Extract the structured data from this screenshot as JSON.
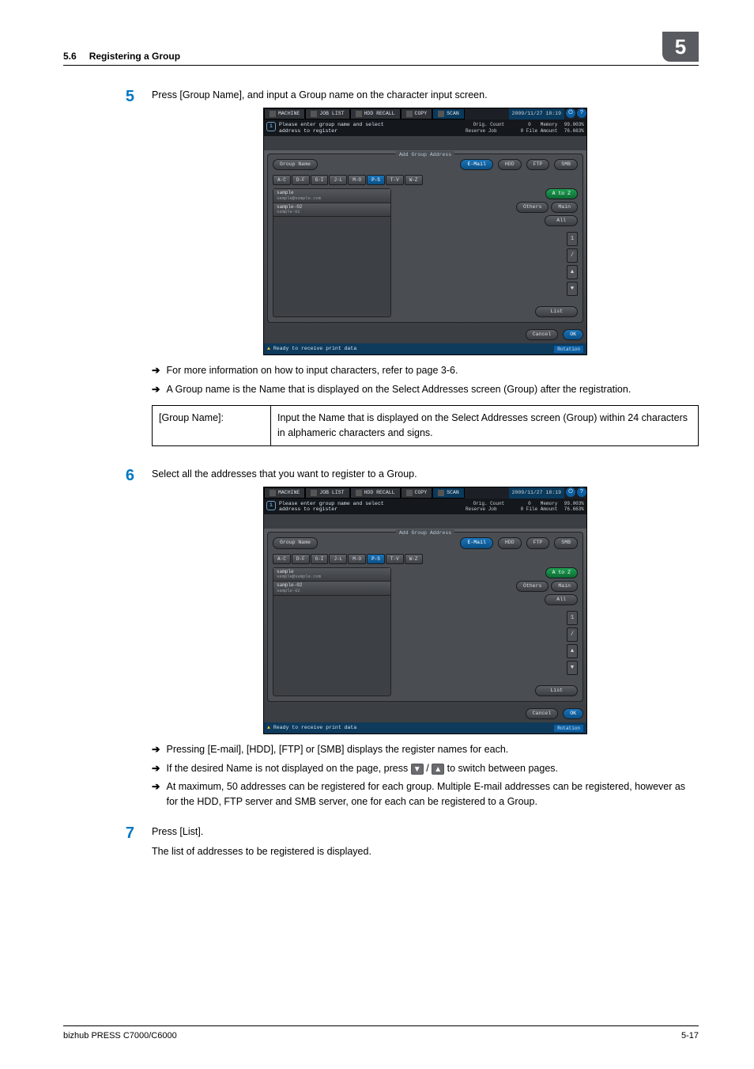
{
  "header": {
    "section_num": "5.6",
    "section_title": "Registering a Group",
    "chapter_num": "5"
  },
  "steps": {
    "s5": {
      "num": "5",
      "text": "Press [Group Name], and input a Group name on the character input screen."
    },
    "s5_arrows": [
      "For more information on how to input characters, refer to page 3-6.",
      "A Group name is the Name that is displayed on the Select Addresses screen (Group) after the registration."
    ],
    "s5_table": {
      "label": "[Group Name]:",
      "desc": "Input the Name that is displayed on the Select Addresses screen (Group) within 24 characters in alphameric characters and signs."
    },
    "s6": {
      "num": "6",
      "text": "Select all the addresses that you want to register to a Group."
    },
    "s6_arrows": [
      "Pressing [E-mail], [HDD], [FTP] or [SMB] displays the register names for each.",
      "If the desired Name is not displayed on the page, press",
      "to switch between pages.",
      "At maximum, 50 addresses can be registered for each group. Multiple E-mail addresses can be registered, however as for the HDD, FTP server and SMB server, one for each can be registered to a Group."
    ],
    "s7": {
      "num": "7",
      "text": "Press [List].",
      "text2": "The list of addresses to be registered is displayed."
    }
  },
  "device": {
    "topbar": {
      "machine": "MACHINE",
      "joblist": "JOB LIST",
      "hddrecall": "HDD RECALL",
      "copy": "COPY",
      "scan": "SCAN",
      "timestamp": "2009/11/27 18:19"
    },
    "info": {
      "msg_l1": "Please enter group name and select",
      "msg_l2": "address to register",
      "orig_count_l": "Orig. Count",
      "orig_count_v": "0",
      "memory_l": "Memory",
      "memory_v": "99.003%",
      "reserve_l": "Reserve Job",
      "reserve_v": "0",
      "fileamt_l": "File Amount",
      "fileamt_v": "76.663%"
    },
    "panel": {
      "title": "Add Group Address",
      "group_name_btn": "Group Name",
      "tabs": {
        "email": "E-Mail",
        "hdd": "HDD",
        "ftp": "FTP",
        "smb": "SMB"
      },
      "alpha": [
        "A-C",
        "D-F",
        "G-I",
        "J-L",
        "M-O",
        "P-S",
        "T-V",
        "W-Z"
      ],
      "alpha_selected": "P-S",
      "list": [
        {
          "name": "sample",
          "sub": "sample@sample.com"
        },
        {
          "name": "sample-02",
          "sub": "sample-02"
        }
      ],
      "right": {
        "atoz": "A to Z",
        "others": "Others",
        "main": "Main",
        "all": "All",
        "slash": "/",
        "list_btn": "List"
      }
    },
    "bottom": {
      "cancel": "Cancel",
      "ok": "OK"
    },
    "status": {
      "text": "Ready to receive print data",
      "rot": "Rotation"
    }
  },
  "footer": {
    "left": "bizhub PRESS C7000/C6000",
    "right": "5-17"
  }
}
